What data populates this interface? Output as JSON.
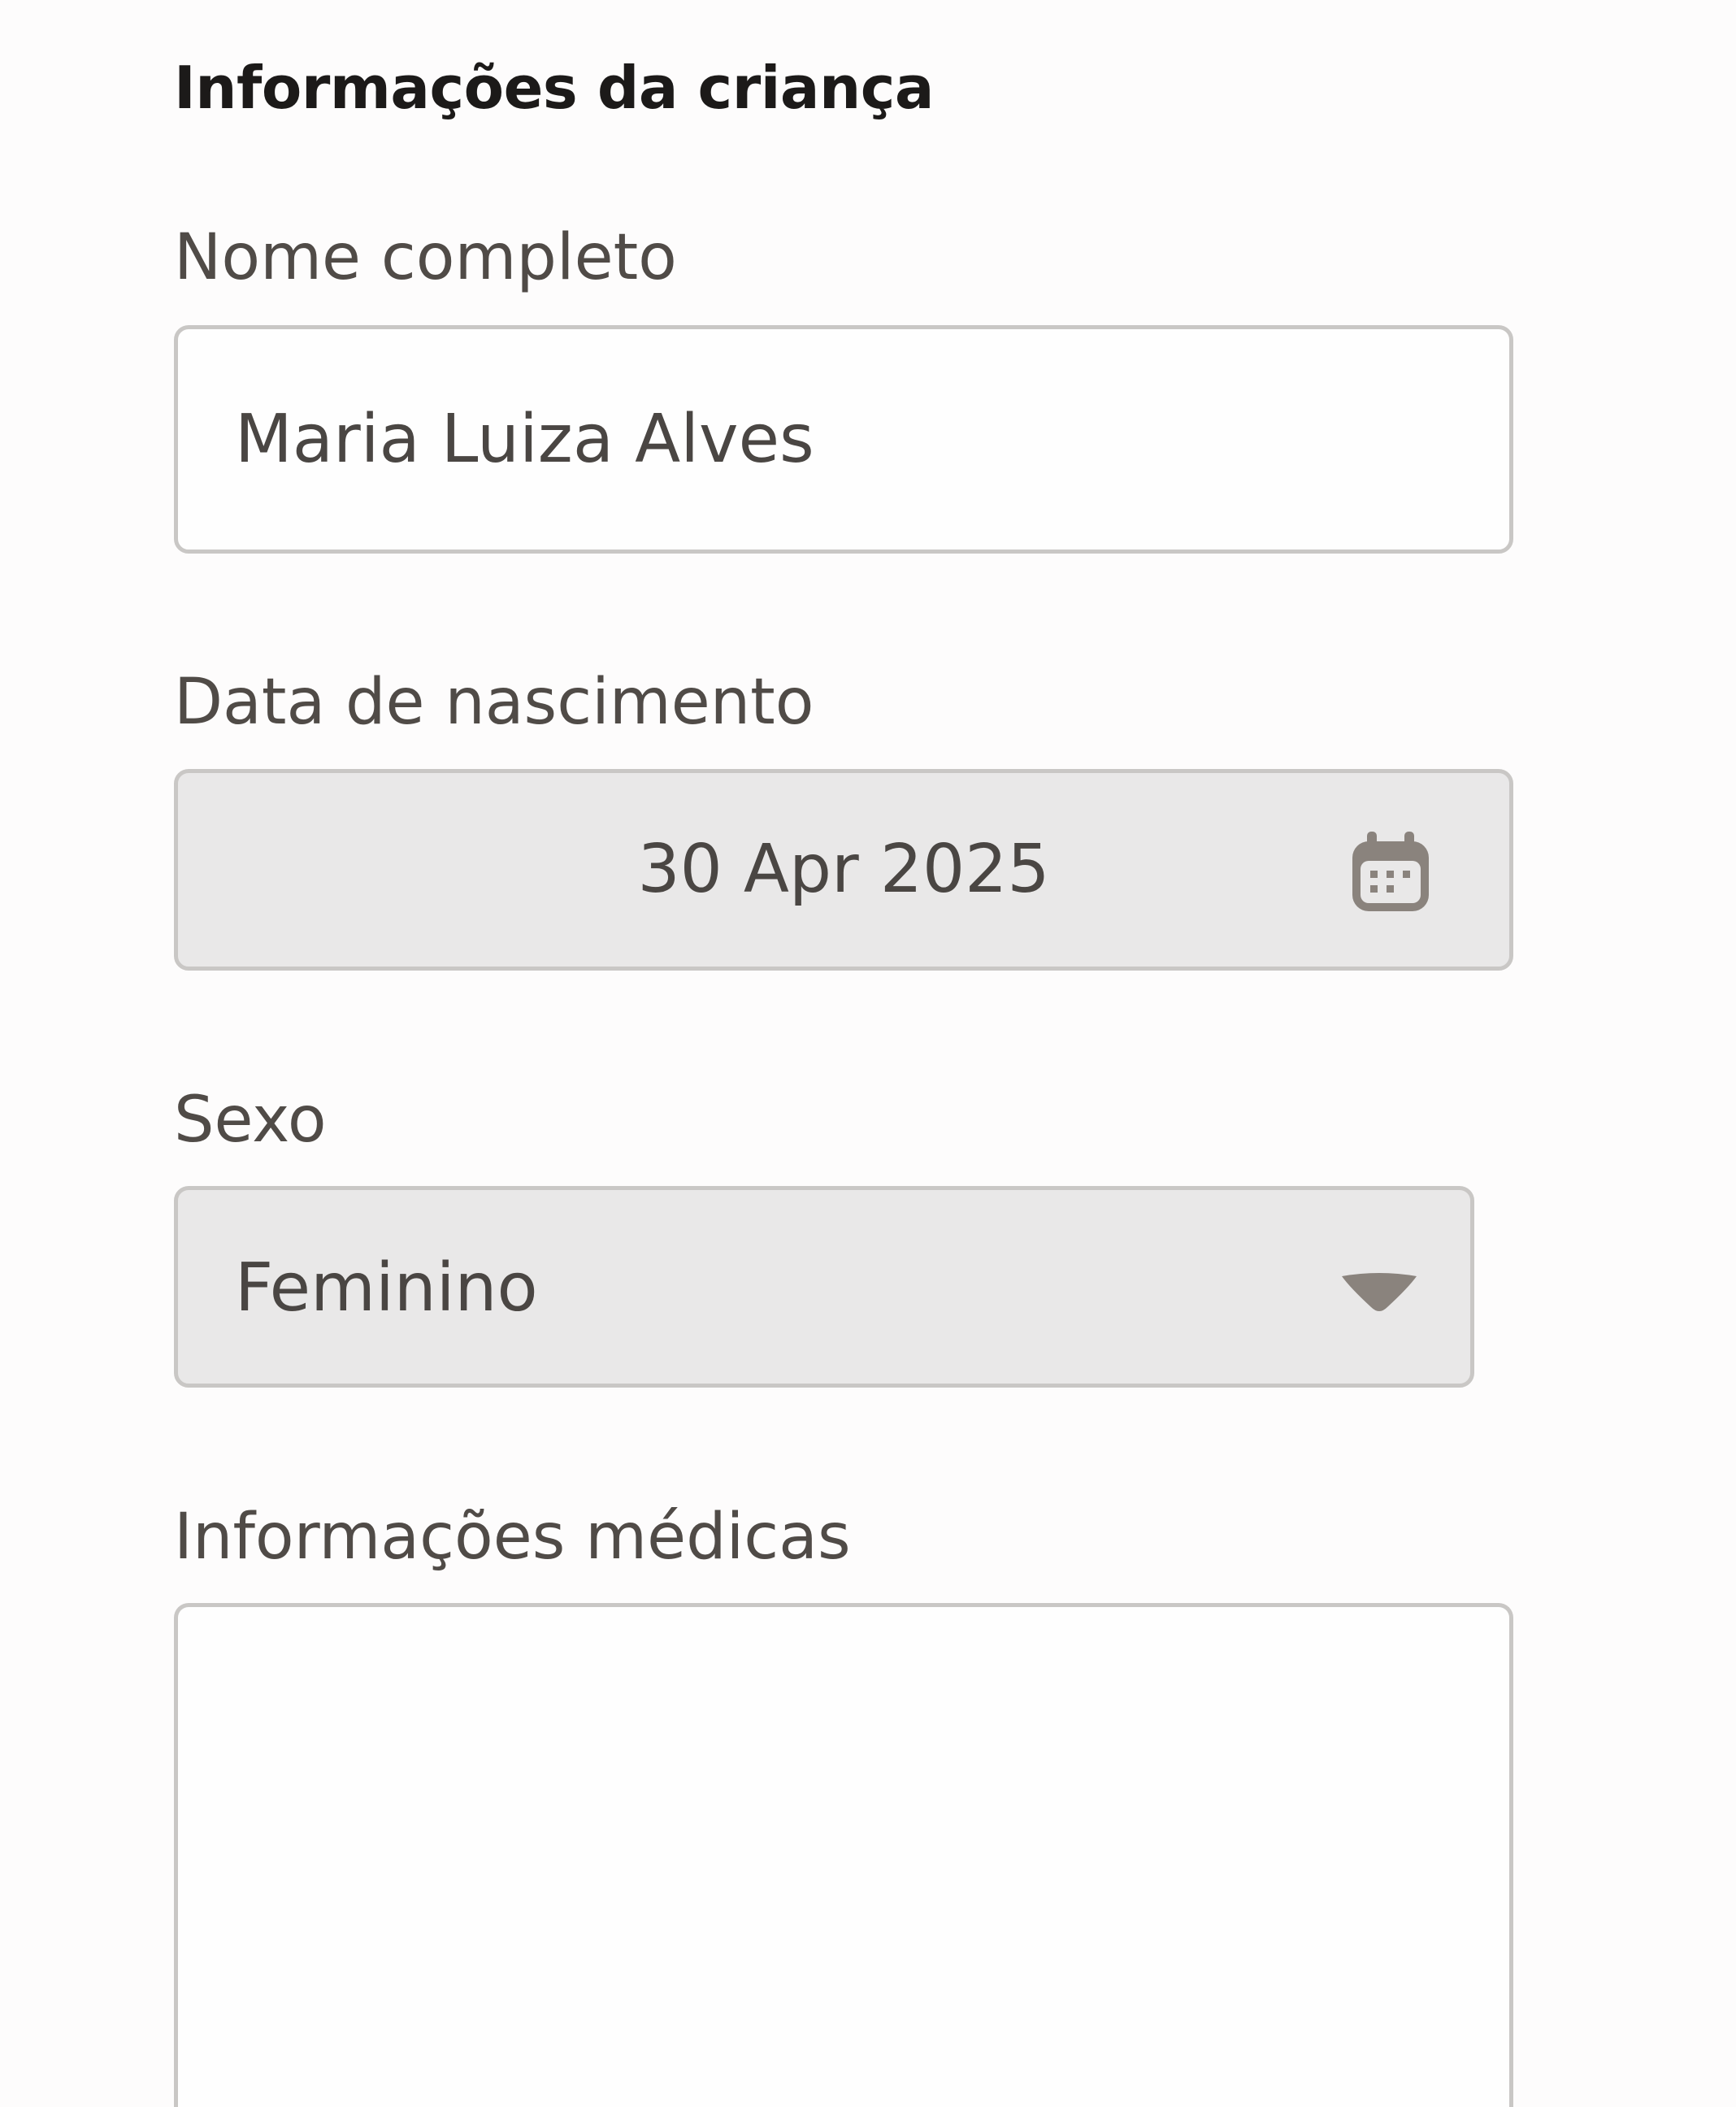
{
  "section": {
    "title": "Informações da criança"
  },
  "fields": {
    "full_name": {
      "label": "Nome completo",
      "value": "Maria Luiza Alves"
    },
    "birth_date": {
      "label": "Data de nascimento",
      "value": "30 Apr 2025",
      "icon": "calendar-icon"
    },
    "sex": {
      "label": "Sexo",
      "selected": "Feminino",
      "icon": "chevron-down-icon"
    },
    "medical_info": {
      "label": "Informações médicas",
      "value": ""
    }
  },
  "colors": {
    "background": "#fdfcfc",
    "heading": "#1c1a19",
    "text": "#4c4844",
    "field_border": "#c9c7c5",
    "disabled_field_bg": "#e9e8e8",
    "icon": "#8a837d"
  }
}
